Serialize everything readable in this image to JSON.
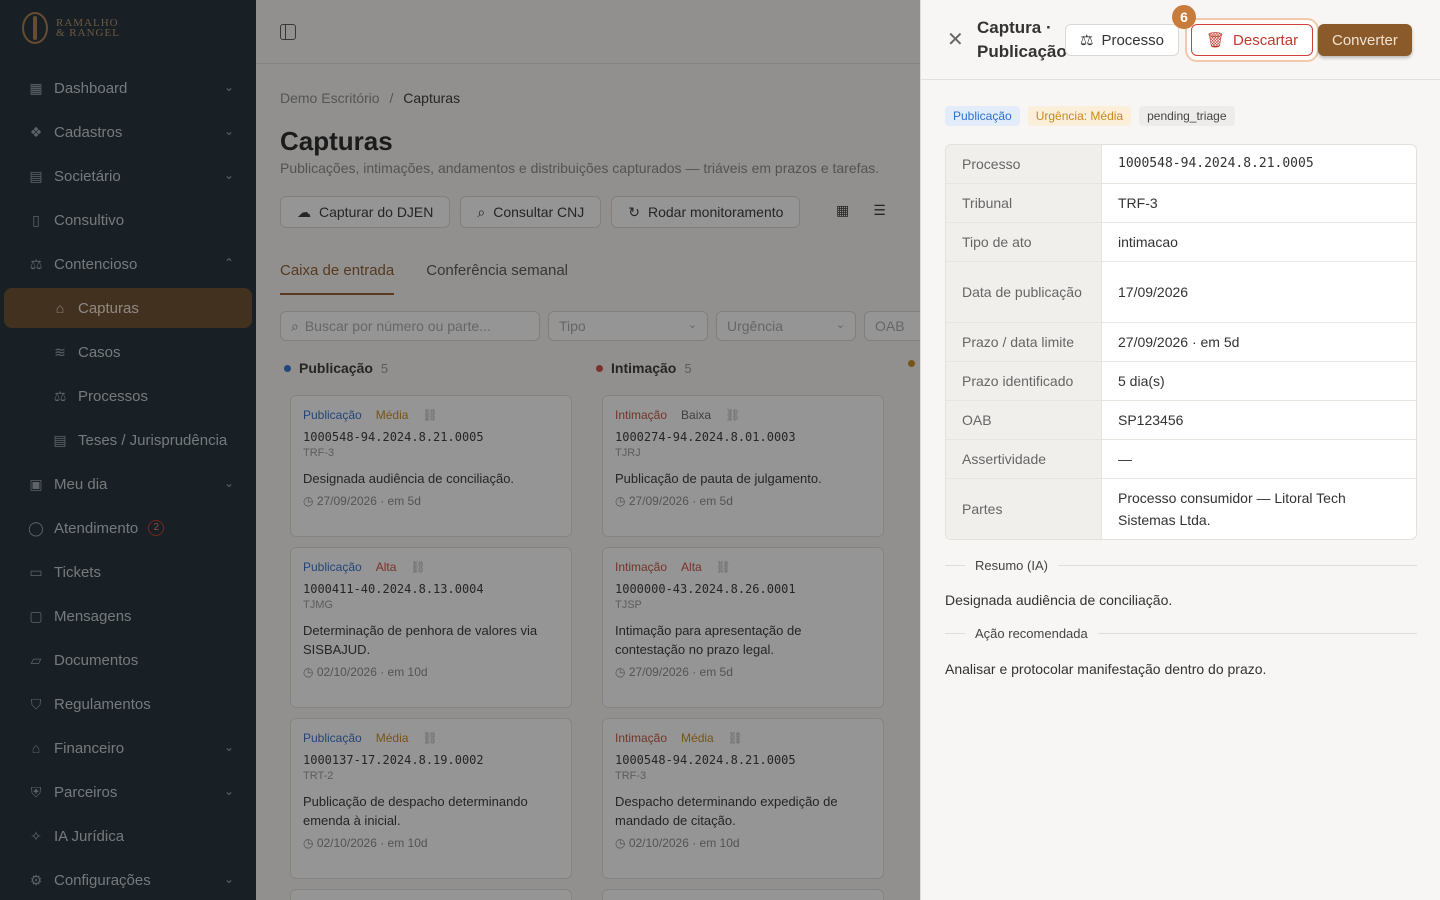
{
  "brand": {
    "line1": "RAMALHO",
    "line2": "& RANGEL"
  },
  "sidebar": {
    "items": [
      {
        "label": "Dashboard",
        "icon": "grid-icon",
        "chevron": "⌄"
      },
      {
        "label": "Cadastros",
        "icon": "boxes-icon",
        "chevron": "⌄"
      },
      {
        "label": "Societário",
        "icon": "building-icon",
        "chevron": "⌄"
      },
      {
        "label": "Consultivo",
        "icon": "book-icon",
        "chevron": ""
      },
      {
        "label": "Contencioso",
        "icon": "scale-icon",
        "chevron": "⌃"
      },
      {
        "label": "Capturas",
        "icon": "inbox-icon"
      },
      {
        "label": "Casos",
        "icon": "layers-icon"
      },
      {
        "label": "Processos",
        "icon": "scale-icon"
      },
      {
        "label": "Teses / Jurisprudência",
        "icon": "library-icon"
      },
      {
        "label": "Meu dia",
        "icon": "calendar-icon",
        "chevron": "⌄"
      },
      {
        "label": "Atendimento",
        "icon": "chat-icon",
        "badge": "2"
      },
      {
        "label": "Tickets",
        "icon": "ticket-icon"
      },
      {
        "label": "Mensagens",
        "icon": "message-icon"
      },
      {
        "label": "Documentos",
        "icon": "folder-icon"
      },
      {
        "label": "Regulamentos",
        "icon": "shield-icon"
      },
      {
        "label": "Financeiro",
        "icon": "bank-icon",
        "chevron": "⌄"
      },
      {
        "label": "Parceiros",
        "icon": "handshake-icon",
        "chevron": "⌄"
      },
      {
        "label": "IA Jurídica",
        "icon": "sparkle-icon"
      },
      {
        "label": "Configurações",
        "icon": "gear-icon",
        "chevron": "⌄"
      }
    ]
  },
  "main": {
    "breadcrumb": {
      "root": "Demo Escritório",
      "sep": "/",
      "current": "Capturas"
    },
    "title": "Capturas",
    "subtitle": "Publicações, intimações, andamentos e distribuições capturados — triáveis em prazos e tarefas.",
    "actions": [
      "Capturar do DJEN",
      "Consultar CNJ",
      "Rodar monitoramento"
    ],
    "tabs": [
      "Caixa de entrada",
      "Conferência semanal"
    ],
    "filters": {
      "search_placeholder": "Buscar por número ou parte...",
      "tipo": "Tipo",
      "urgencia": "Urgência",
      "oab": "OAB"
    },
    "columns": [
      {
        "name": "Publicação",
        "count": "5",
        "color": "#2f6fd0"
      },
      {
        "name": "Intimação",
        "count": "5",
        "color": "#d04a3a"
      }
    ],
    "cards": [
      {
        "type": "Publicação",
        "urgency": "Média",
        "num": "1000548-94.2024.8.21.0005",
        "court": "TRF-3",
        "desc": "Designada audiência de conciliação.",
        "due": "27/09/2026 · em 5d"
      },
      {
        "type": "Publicação",
        "urgency": "Alta",
        "num": "1000411-40.2024.8.13.0004",
        "court": "TJMG",
        "desc": "Determinação de penhora de valores via SISBAJUD.",
        "due": "02/10/2026 · em 10d"
      },
      {
        "type": "Publicação",
        "urgency": "Média",
        "num": "1000137-17.2024.8.19.0002",
        "court": "TRT-2",
        "desc": "Publicação de despacho determinando emenda à inicial.",
        "due": "02/10/2026 · em 10d"
      },
      {
        "type": "Intimação",
        "urgency": "Baixa",
        "num": "1000274-94.2024.8.01.0003",
        "court": "TJRJ",
        "desc": "Publicação de pauta de julgamento.",
        "due": "27/09/2026 · em 5d"
      },
      {
        "type": "Intimação",
        "urgency": "Alta",
        "num": "1000000-43.2024.8.26.0001",
        "court": "TJSP",
        "desc": "Intimação para apresentação de contestação no prazo legal.",
        "due": "27/09/2026 · em 5d"
      },
      {
        "type": "Intimação",
        "urgency": "Média",
        "num": "1000548-94.2024.8.21.0005",
        "court": "TRF-3",
        "desc": "Despacho determinando expedição de mandado de citação.",
        "due": "02/10/2026 · em 10d"
      }
    ]
  },
  "drawer": {
    "title": "Captura · Publicação",
    "buttons": {
      "processo": "Processo",
      "descartar": "Descartar",
      "converter": "Converter"
    },
    "step_badge": "6",
    "pills": {
      "tipo": "Publicação",
      "urgencia": "Urgência: Média",
      "status": "pending_triage"
    },
    "fields": [
      {
        "k": "Processo",
        "v": "1000548-94.2024.8.21.0005"
      },
      {
        "k": "Tribunal",
        "v": "TRF-3"
      },
      {
        "k": "Tipo de ato",
        "v": "intimacao"
      },
      {
        "k": "Data de publicação",
        "v": "17/09/2026"
      },
      {
        "k": "Prazo / data limite",
        "v": "27/09/2026 · em 5d"
      },
      {
        "k": "Prazo identificado",
        "v": "5 dia(s)"
      },
      {
        "k": "OAB",
        "v": "SP123456"
      },
      {
        "k": "Assertividade",
        "v": "—"
      },
      {
        "k": "Partes",
        "v": "Processo consumidor — Litoral Tech Sistemas Ltda."
      }
    ],
    "resumo_label": "Resumo (IA)",
    "resumo": "Designada audiência de conciliação.",
    "acao_label": "Ação recomendada",
    "acao": "Analisar e protocolar manifestação dentro do prazo."
  }
}
